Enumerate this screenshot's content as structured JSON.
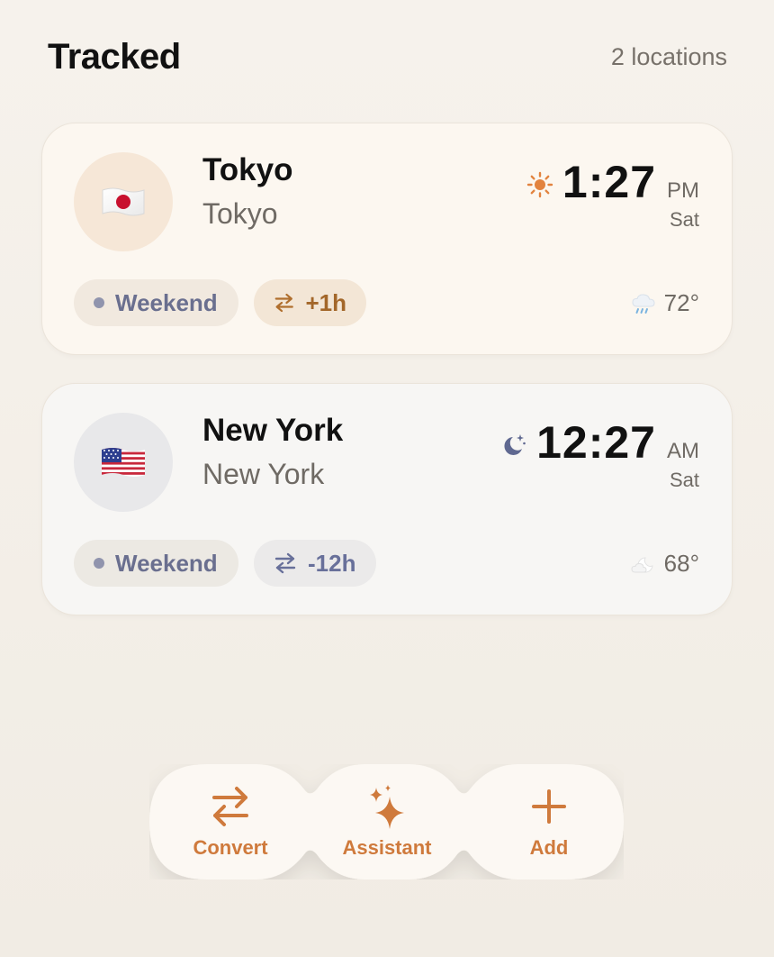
{
  "header": {
    "title": "Tracked",
    "count": "2 locations"
  },
  "cards": [
    {
      "flag": "🇯🇵",
      "city": "Tokyo",
      "subtitle": "Tokyo",
      "time_icon": "sun-icon",
      "time": "1:27",
      "ampm": "PM",
      "day": "Sat",
      "weekend_label": "Weekend",
      "offset_label": "+1h",
      "weather_icon": "rain-cloud-icon",
      "temperature": "72°"
    },
    {
      "flag": "🇺🇸",
      "city": "New York",
      "subtitle": "New York",
      "time_icon": "moon-stars-icon",
      "time": "12:27",
      "ampm": "AM",
      "day": "Sat",
      "weekend_label": "Weekend",
      "offset_label": "-12h",
      "weather_icon": "moon-cloud-icon",
      "temperature": "68°"
    }
  ],
  "dock": {
    "convert_label": "Convert",
    "assistant_label": "Assistant",
    "add_label": "Add"
  },
  "colors": {
    "accent": "#cf7a3c",
    "warm_card": "#fcf7f0",
    "cool_card": "#f7f6f4",
    "chip_text": "#6a6f8f"
  }
}
